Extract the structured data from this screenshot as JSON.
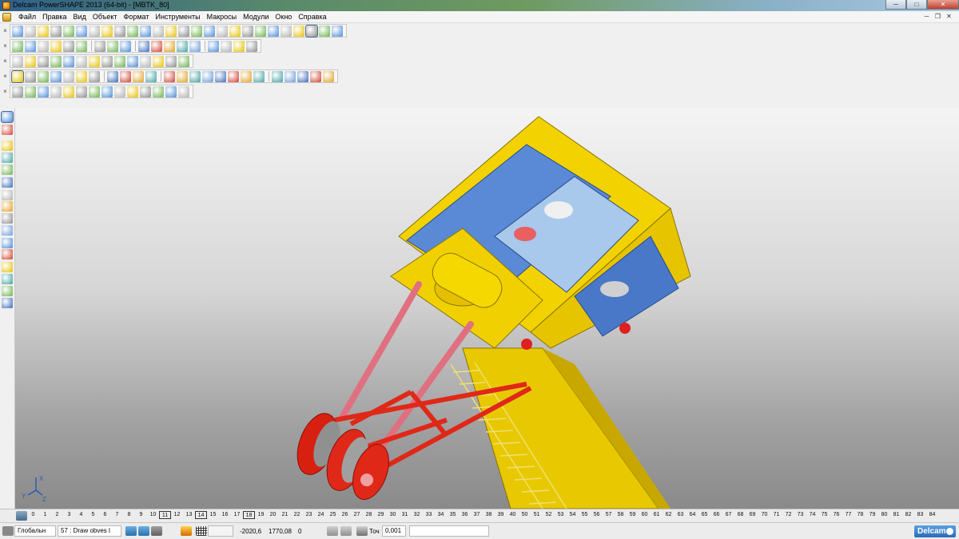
{
  "window": {
    "title": "Delcam PowerSHAPE 2013 (64-bit) - [MBTK_80]",
    "controls": {
      "minimize": "─",
      "maximize": "□",
      "close": "✕"
    }
  },
  "menu": {
    "items": [
      "Файл",
      "Правка",
      "Вид",
      "Объект",
      "Формат",
      "Инструменты",
      "Макросы",
      "Модули",
      "Окно",
      "Справка"
    ],
    "mdi_controls": {
      "minimize": "─",
      "restore": "❐",
      "close": "✕"
    }
  },
  "toolbars": {
    "close_glyph": "×"
  },
  "viewport": {
    "background_top": "#f4f4f4",
    "background_bottom": "#8a8a8a",
    "triad": {
      "x_label": "X",
      "y_label": "Y",
      "z_label": "Z"
    },
    "model_colors": {
      "frame": "#f2d200",
      "plates": "#5a8ad6",
      "arm": "#e03020",
      "rods": "#e8707a",
      "ladder": "#f0e070"
    }
  },
  "levels": {
    "numbers": [
      "0",
      "1",
      "2",
      "3",
      "4",
      "5",
      "6",
      "7",
      "8",
      "9",
      "10",
      "11",
      "12",
      "13",
      "14",
      "15",
      "16",
      "17",
      "18",
      "19",
      "20",
      "21",
      "22",
      "23",
      "24",
      "25",
      "26",
      "27",
      "28",
      "29",
      "30",
      "31",
      "32",
      "33",
      "34",
      "35",
      "36",
      "37",
      "38",
      "39",
      "40",
      "50",
      "51",
      "52",
      "53",
      "54",
      "55",
      "56",
      "57",
      "58",
      "59",
      "60",
      "61",
      "62",
      "63",
      "64",
      "65",
      "66",
      "67",
      "68",
      "69",
      "70",
      "71",
      "72",
      "73",
      "74",
      "75",
      "76",
      "77",
      "78",
      "79",
      "80",
      "81",
      "82",
      "83",
      "84"
    ],
    "boxed": [
      "11",
      "14",
      "18"
    ]
  },
  "status": {
    "workplane": "Глобальн",
    "level_selector": "57 : Draw obves l",
    "x_coord": "-2020,6",
    "y_coord": "1770,08",
    "z_coord": "0",
    "tolerance_label": "Точ",
    "tolerance_value": "0,001",
    "brand": "Delcam"
  }
}
